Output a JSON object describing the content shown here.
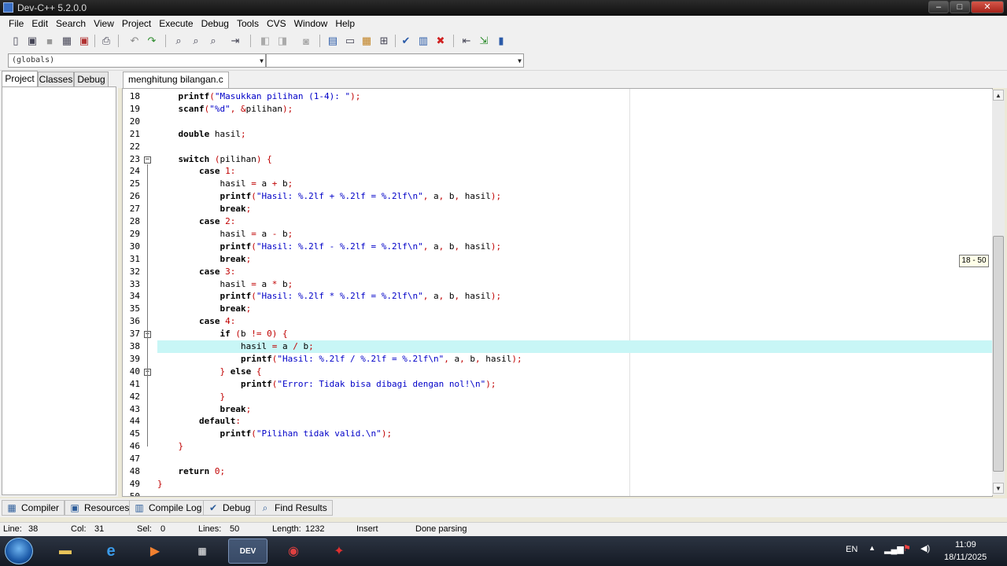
{
  "window": {
    "title": "Dev-C++ 5.2.0.0",
    "minimize": "–",
    "maximize": "□",
    "close": "✕"
  },
  "menu": [
    "File",
    "Edit",
    "Search",
    "View",
    "Project",
    "Execute",
    "Debug",
    "Tools",
    "CVS",
    "Window",
    "Help"
  ],
  "toolbar_icons": [
    "new-file-icon",
    "open-icon",
    "save-icon",
    "save-all-icon",
    "close-file-icon",
    "print-icon",
    "undo-icon",
    "redo-icon",
    "find-icon",
    "replace-icon",
    "find-next-icon",
    "goto-line-icon",
    "bookmark-add-icon",
    "bookmark-prev-icon",
    "bookmark-next-icon",
    "new-project-icon",
    "insert-icon",
    "toggle-bookmark-icon",
    "class-browser-icon",
    "compile-icon",
    "run-icon",
    "rebuild-icon",
    "debug-icon",
    "exit-icon",
    "about-icon",
    "help-icon"
  ],
  "class_combo": {
    "scope": "(globals)",
    "members": ""
  },
  "left_tabs": [
    "Project",
    "Classes",
    "Debug"
  ],
  "file_tab": "menghitung bilangan.c",
  "scroll_tooltip": "18 - 50",
  "code_lines": [
    {
      "n": "18",
      "text": "    printf(\"Masukkan pilihan (1-4): \");"
    },
    {
      "n": "19",
      "text": "    scanf(\"%d\", &pilihan);"
    },
    {
      "n": "20",
      "text": ""
    },
    {
      "n": "21",
      "text": "    double hasil;"
    },
    {
      "n": "22",
      "text": ""
    },
    {
      "n": "23",
      "text": "    switch (pilihan) {"
    },
    {
      "n": "24",
      "text": "        case 1:"
    },
    {
      "n": "25",
      "text": "            hasil = a + b;"
    },
    {
      "n": "26",
      "text": "            printf(\"Hasil: %.2lf + %.2lf = %.2lf\\n\", a, b, hasil);"
    },
    {
      "n": "27",
      "text": "            break;"
    },
    {
      "n": "28",
      "text": "        case 2:"
    },
    {
      "n": "29",
      "text": "            hasil = a - b;"
    },
    {
      "n": "30",
      "text": "            printf(\"Hasil: %.2lf - %.2lf = %.2lf\\n\", a, b, hasil);"
    },
    {
      "n": "31",
      "text": "            break;"
    },
    {
      "n": "32",
      "text": "        case 3:"
    },
    {
      "n": "33",
      "text": "            hasil = a * b;"
    },
    {
      "n": "34",
      "text": "            printf(\"Hasil: %.2lf * %.2lf = %.2lf\\n\", a, b, hasil);"
    },
    {
      "n": "35",
      "text": "            break;"
    },
    {
      "n": "36",
      "text": "        case 4:"
    },
    {
      "n": "37",
      "text": "            if (b != 0) {"
    },
    {
      "n": "38",
      "text": "                hasil = a / b;"
    },
    {
      "n": "39",
      "text": "                printf(\"Hasil: %.2lf / %.2lf = %.2lf\\n\", a, b, hasil);"
    },
    {
      "n": "40",
      "text": "            } else {"
    },
    {
      "n": "41",
      "text": "                printf(\"Error: Tidak bisa dibagi dengan nol!\\n\");"
    },
    {
      "n": "42",
      "text": "            }"
    },
    {
      "n": "43",
      "text": "            break;"
    },
    {
      "n": "44",
      "text": "        default:"
    },
    {
      "n": "45",
      "text": "            printf(\"Pilihan tidak valid.\\n\");"
    },
    {
      "n": "46",
      "text": "    }"
    },
    {
      "n": "47",
      "text": ""
    },
    {
      "n": "48",
      "text": "    return 0;"
    },
    {
      "n": "49",
      "text": "}"
    },
    {
      "n": "50",
      "text": ""
    }
  ],
  "current_line": "38",
  "bottom_tabs": [
    {
      "label": "Compiler",
      "icon": "compiler-grid-icon"
    },
    {
      "label": "Resources",
      "icon": "resources-icon"
    },
    {
      "label": "Compile Log",
      "icon": "compile-log-chart-icon"
    },
    {
      "label": "Debug",
      "icon": "debug-check-icon"
    },
    {
      "label": "Find Results",
      "icon": "find-results-icon"
    }
  ],
  "status": {
    "line_label": "Line:",
    "line": "38",
    "col_label": "Col:",
    "col": "31",
    "sel_label": "Sel:",
    "sel": "0",
    "lines_label": "Lines:",
    "lines": "50",
    "length_label": "Length:",
    "length": "1232",
    "mode": "Insert",
    "message": "Done parsing"
  },
  "taskbar": {
    "apps": [
      "explorer-icon",
      "internet-explorer-icon",
      "media-player-icon",
      "calendar-icon",
      "devcpp-icon",
      "chrome-icon",
      "acrobat-icon"
    ],
    "active_app": "DEV",
    "lang": "EN",
    "time": "11:09",
    "date": "18/11/2025"
  },
  "colors": {
    "current_line": "#c8f6f6",
    "string": "#0000c8",
    "number": "#c00000",
    "title_bar": "#1a1a1a"
  }
}
